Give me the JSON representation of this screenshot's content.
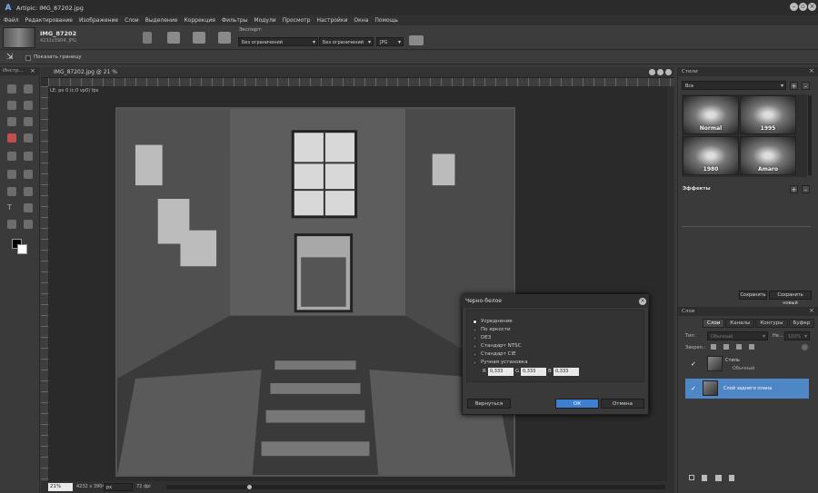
{
  "app": {
    "title": "Artipic: IMG_87202.jpg"
  },
  "menu": [
    "Файл",
    "Редактирование",
    "Изображение",
    "Слои",
    "Выделение",
    "Коррекция",
    "Фильтры",
    "Модули",
    "Просмотр",
    "Настройки",
    "Окна",
    "Помощь"
  ],
  "file": {
    "name": "IMG_87202",
    "meta": "4232x3904, JPG"
  },
  "export": {
    "label": "Экспорт:",
    "width_value": "Без ограничений",
    "height_value": "Без ограничений",
    "format_value": "JPG"
  },
  "options": {
    "show_border": "Показать границу"
  },
  "toolbox": {
    "title": "Инстр..."
  },
  "document": {
    "tab": "IMG_87202.jpg @ 21 %",
    "info": "LE: px 0 (c:0 vp0) fps",
    "zoom": "21%",
    "dims": "4232 x 3904",
    "unit": "px",
    "dpi": "72 dpi"
  },
  "dialog": {
    "title": "Черно-белое",
    "options": [
      "Усреднение",
      "По яркости",
      "DE3",
      "Стандарт NTSC",
      "Стандарт CIE",
      "Ручная установка"
    ],
    "selected_index": 0,
    "labels": [
      "R",
      "G",
      "B"
    ],
    "values": [
      "0,333",
      "0,333",
      "0,333"
    ],
    "reset": "Вернуться",
    "ok": "ОК",
    "cancel": "Отмена"
  },
  "styles": {
    "title": "Стили",
    "filter": "Все",
    "items": [
      "Normal",
      "1995",
      "1980",
      "Amaro"
    ],
    "effects_label": "Эффекты",
    "save": "Сохранить",
    "save_new": "Сохранить новый"
  },
  "layers": {
    "title": "Слои",
    "tabs": [
      "Слои",
      "Каналы",
      "Контуры",
      "Буфер"
    ],
    "type_label": "Тип:",
    "blend_value": "Обычный",
    "opacity_label": "Не...",
    "opacity_value": "100%",
    "lock_label": "Закреп.:",
    "items": [
      {
        "name": "Стиль",
        "sub": "Обычный"
      },
      {
        "name": "Слой заднего плана",
        "sub": ""
      }
    ]
  },
  "colors": {
    "accent": "#4a90d9",
    "selected_layer": "#4f86c6",
    "ok_button": "#3d7fd0"
  }
}
